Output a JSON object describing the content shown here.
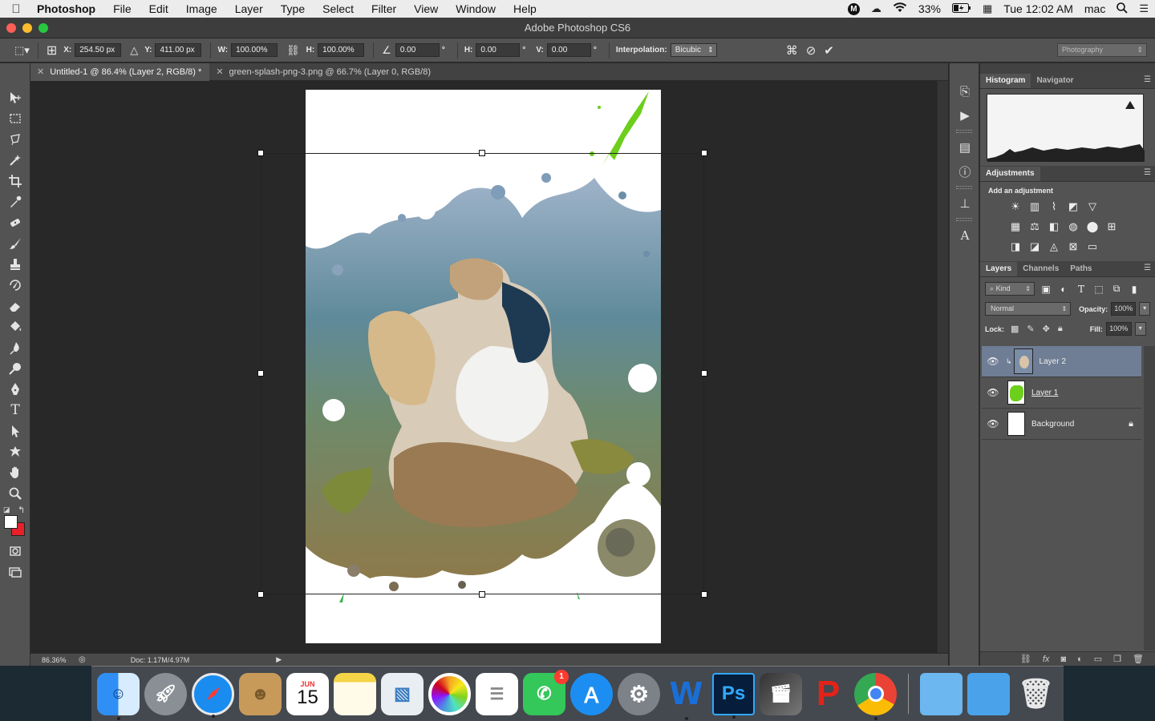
{
  "menubar": {
    "app_name": "Photoshop",
    "items": [
      "File",
      "Edit",
      "Image",
      "Layer",
      "Type",
      "Select",
      "Filter",
      "View",
      "Window",
      "Help"
    ],
    "status": {
      "battery": "33%",
      "clock": "Tue 12:02 AM",
      "user": "mac",
      "m_badge": "M"
    }
  },
  "window": {
    "title": "Adobe Photoshop CS6"
  },
  "options": {
    "x_label": "X:",
    "x_value": "254.50 px",
    "y_label": "Y:",
    "y_value": "411.00 px",
    "w_label": "W:",
    "w_value": "100.00%",
    "h_label": "H:",
    "h_value": "100.00%",
    "angle_value": "0.00",
    "angle_unit": "°",
    "hskew_label": "H:",
    "hskew_value": "0.00",
    "hskew_unit": "°",
    "vskew_label": "V:",
    "vskew_value": "0.00",
    "vskew_unit": "°",
    "interp_label": "Interpolation:",
    "interp_value": "Bicubic",
    "workspace": "Photography"
  },
  "tabs": [
    {
      "label": "Untitled-1 @ 86.4% (Layer 2, RGB/8) *",
      "active": true
    },
    {
      "label": "green-splash-png-3.png @ 66.7% (Layer 0, RGB/8)",
      "active": false
    }
  ],
  "status": {
    "zoom": "86.36%",
    "doc": "Doc: 1.17M/4.97M"
  },
  "panels": {
    "histogram_tabs": [
      "Histogram",
      "Navigator"
    ],
    "adjustments_tab": "Adjustments",
    "adjustments_title": "Add an adjustment",
    "layers_tabs": [
      "Layers",
      "Channels",
      "Paths"
    ],
    "kind_label": "Kind",
    "blend_mode": "Normal",
    "opacity_label": "Opacity:",
    "opacity_value": "100%",
    "lock_label": "Lock:",
    "fill_label": "Fill:",
    "fill_value": "100%",
    "layers": [
      {
        "name": "Layer 2",
        "active": true
      },
      {
        "name": "Layer 1",
        "active": false
      },
      {
        "name": "Background",
        "active": false
      }
    ]
  },
  "dock": {
    "calendar_month": "JUN",
    "calendar_day": "15",
    "facetime_badge": "1",
    "word_letter": "W",
    "ps_letters": "Ps"
  },
  "colors": {
    "foreground": "#ffffff",
    "background": "#e8202a",
    "selected_layer": "#6f7d95"
  }
}
